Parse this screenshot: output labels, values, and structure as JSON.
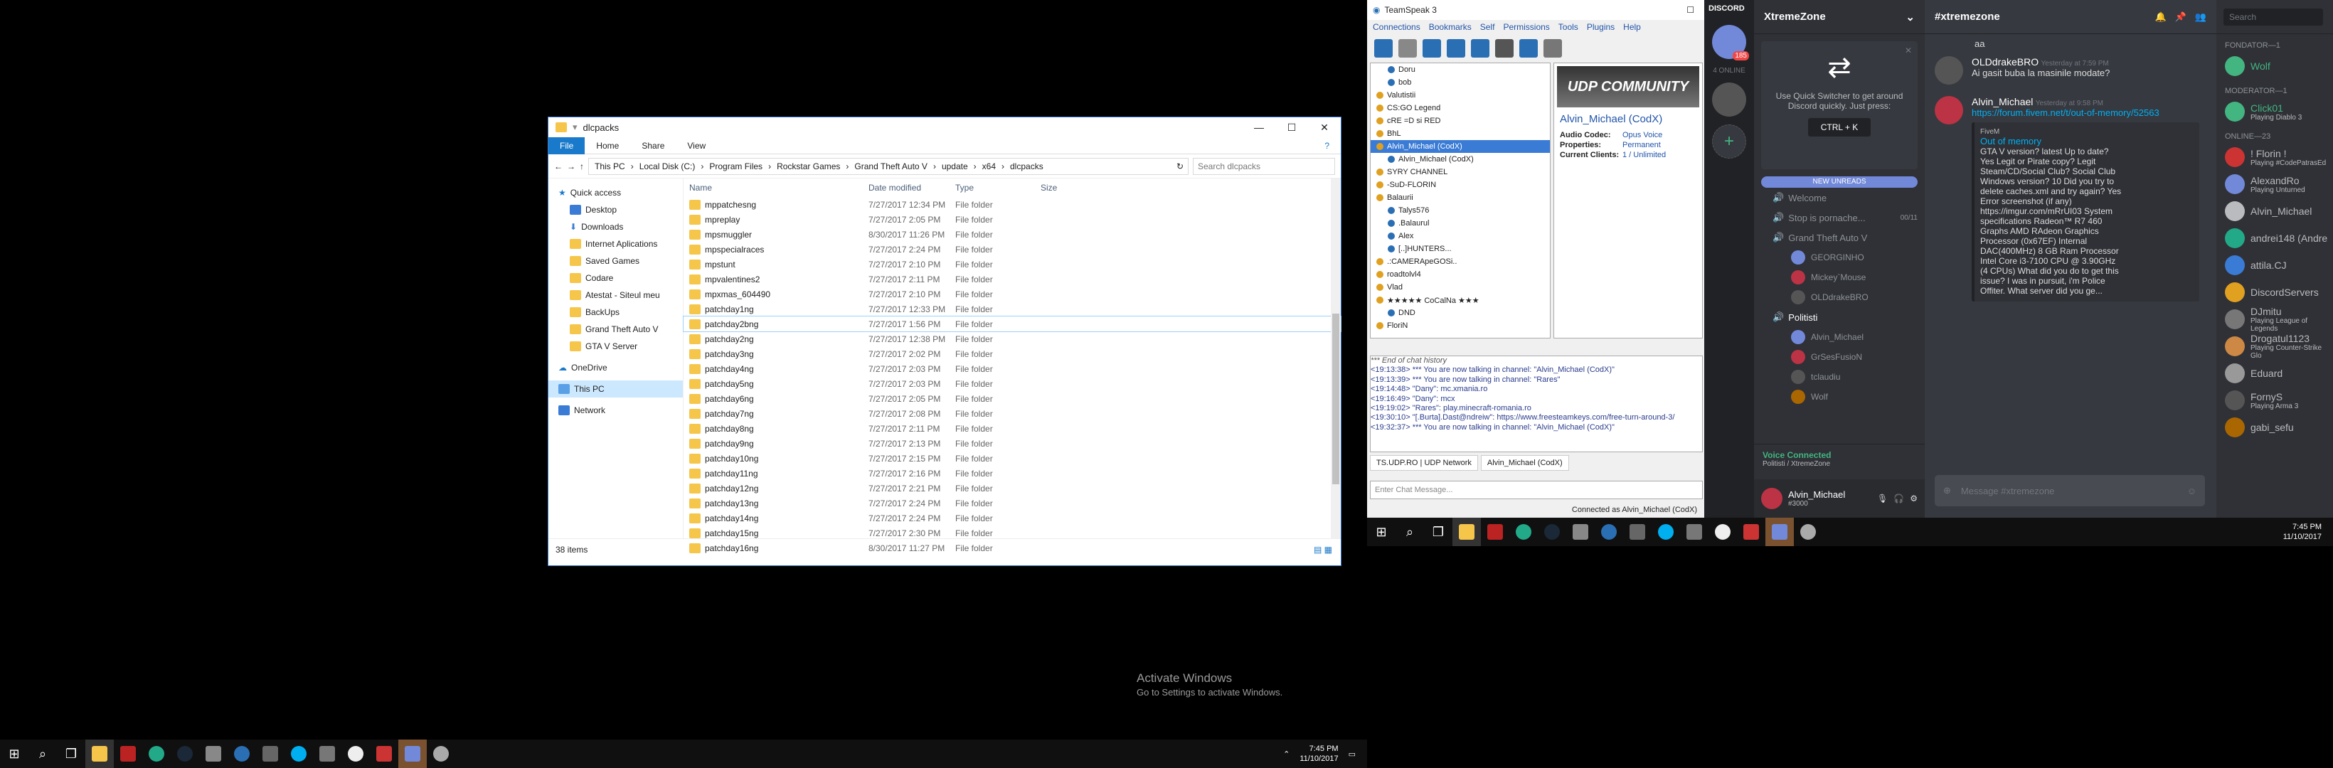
{
  "explorer": {
    "title": "dlcpacks",
    "tabs": [
      "File",
      "Home",
      "Share",
      "View"
    ],
    "path": [
      "This PC",
      "Local Disk (C:)",
      "Program Files",
      "Rockstar Games",
      "Grand Theft Auto V",
      "update",
      "x64",
      "dlcpacks"
    ],
    "search_placeholder": "Search dlcpacks",
    "nav": {
      "quick_access": "Quick access",
      "items": [
        "Desktop",
        "Downloads",
        "Internet Aplications",
        "Saved Games",
        "Codare",
        "Atestat - Siteul meu",
        "BackUps",
        "Grand Theft Auto V",
        "GTA V Server"
      ],
      "onedrive": "OneDrive",
      "this_pc": "This PC",
      "network": "Network"
    },
    "columns": {
      "name": "Name",
      "date": "Date modified",
      "type": "Type",
      "size": "Size"
    },
    "rows": [
      {
        "name": "mppatchesng",
        "date": "7/27/2017 12:34 PM",
        "type": "File folder"
      },
      {
        "name": "mpreplay",
        "date": "7/27/2017 2:05 PM",
        "type": "File folder"
      },
      {
        "name": "mpsmuggler",
        "date": "8/30/2017 11:26 PM",
        "type": "File folder"
      },
      {
        "name": "mpspecialraces",
        "date": "7/27/2017 2:24 PM",
        "type": "File folder"
      },
      {
        "name": "mpstunt",
        "date": "7/27/2017 2:10 PM",
        "type": "File folder"
      },
      {
        "name": "mpvalentines2",
        "date": "7/27/2017 2:11 PM",
        "type": "File folder"
      },
      {
        "name": "mpxmas_604490",
        "date": "7/27/2017 2:10 PM",
        "type": "File folder"
      },
      {
        "name": "patchday1ng",
        "date": "7/27/2017 12:33 PM",
        "type": "File folder"
      },
      {
        "name": "patchday2bng",
        "date": "7/27/2017 1:56 PM",
        "type": "File folder"
      },
      {
        "name": "patchday2ng",
        "date": "7/27/2017 12:38 PM",
        "type": "File folder"
      },
      {
        "name": "patchday3ng",
        "date": "7/27/2017 2:02 PM",
        "type": "File folder"
      },
      {
        "name": "patchday4ng",
        "date": "7/27/2017 2:03 PM",
        "type": "File folder"
      },
      {
        "name": "patchday5ng",
        "date": "7/27/2017 2:03 PM",
        "type": "File folder"
      },
      {
        "name": "patchday6ng",
        "date": "7/27/2017 2:05 PM",
        "type": "File folder"
      },
      {
        "name": "patchday7ng",
        "date": "7/27/2017 2:08 PM",
        "type": "File folder"
      },
      {
        "name": "patchday8ng",
        "date": "7/27/2017 2:11 PM",
        "type": "File folder"
      },
      {
        "name": "patchday9ng",
        "date": "7/27/2017 2:13 PM",
        "type": "File folder"
      },
      {
        "name": "patchday10ng",
        "date": "7/27/2017 2:15 PM",
        "type": "File folder"
      },
      {
        "name": "patchday11ng",
        "date": "7/27/2017 2:16 PM",
        "type": "File folder"
      },
      {
        "name": "patchday12ng",
        "date": "7/27/2017 2:21 PM",
        "type": "File folder"
      },
      {
        "name": "patchday13ng",
        "date": "7/27/2017 2:24 PM",
        "type": "File folder"
      },
      {
        "name": "patchday14ng",
        "date": "7/27/2017 2:24 PM",
        "type": "File folder"
      },
      {
        "name": "patchday15ng",
        "date": "7/27/2017 2:30 PM",
        "type": "File folder"
      },
      {
        "name": "patchday16ng",
        "date": "8/30/2017 11:27 PM",
        "type": "File folder"
      }
    ],
    "status": "38 items"
  },
  "teamspeak": {
    "title": "TeamSpeak 3",
    "menu": [
      "Connections",
      "Bookmarks",
      "Self",
      "Permissions",
      "Tools",
      "Plugins",
      "Help"
    ],
    "tree": [
      "Doru",
      "bob",
      "Valutistii",
      "CS:GO Legend",
      "cRE =D si RED",
      "BhL",
      "Alvin_Michael (CodX)",
      "Alvin_Michael (CodX)",
      "SYRY CHANNEL",
      "-SuD-FLORIN",
      "Balaurii",
      "Talys576",
      ".Balaurul",
      "Alex",
      "[..]HUNTERS...",
      ".:CAMERApeGOSi..",
      "roadtolvl4",
      "Vlad",
      "★★★★★ CoCalNa ★★★",
      "DND",
      "FloriN"
    ],
    "banner": "UDP COMMUNITY",
    "selected_client": "Alvin_Michael (CodX)",
    "info": [
      {
        "k": "Audio Codec:",
        "v": "Opus Voice"
      },
      {
        "k": "Properties:",
        "v": "Permanent"
      },
      {
        "k": "Current Clients:",
        "v": "1 / Unlimited"
      }
    ],
    "chat": [
      "*** End of chat history",
      "<19:13:38> *** You are now talking in channel: \"Alvin_Michael (CodX)\"",
      "<19:13:39> *** You are now talking in channel: \"Rares\"",
      "<19:14:48> \"Dany\": mc.xmania.ro",
      "<19:16:49> \"Dany\": mcx",
      "<19:19:02> \"Rares\": play.minecraft-romania.ro",
      "<19:30:10> \"[.Burta].Dast@ndreiw\": https://www.freesteamkeys.com/free-turn-around-3/",
      "<19:32:37> *** You are now talking in channel: \"Alvin_Michael (CodX)\""
    ],
    "tabs": [
      "TS.UDP.RO | UDP Network",
      "Alvin_Michael (CodX)"
    ],
    "input_placeholder": "Enter Chat Message...",
    "status": "Connected as Alvin_Michael (CodX)"
  },
  "discord": {
    "brand": "DISCORD",
    "server": "XtremeZone",
    "online": "4 ONLINE",
    "badge": "185",
    "quickswitch": {
      "text": "Use Quick Switcher to get around Discord quickly. Just press:",
      "keys": "CTRL + K"
    },
    "new_unreads": "NEW UNREADS",
    "channels": [
      "Welcome",
      "Stop is pornache...",
      "Grand Theft Auto V"
    ],
    "channel_count": "00/11",
    "voice_users_1": [
      "GEORGINHO",
      "Mickey`Mouse",
      "OLDdrakeBRO"
    ],
    "voice_channel_2": "Politisti",
    "voice_users_2": [
      "Alvin_Michael",
      "GrSesFusioN",
      "tclaudiu",
      "Wolf"
    ],
    "voice_connected": "Voice Connected",
    "voice_sub": "Politisti / XtremeZone",
    "user": {
      "name": "Alvin_Michael",
      "tag": "#3000"
    },
    "channel_title": "#xtremezone",
    "search": "Search",
    "messages": [
      {
        "author": "OLDdrakeBRO",
        "time": "Yesterday at 7:59 PM",
        "text": "Ai gasit buba la masinile modate?"
      },
      {
        "author": "Alvin_Michael",
        "time": "Yesterday at 9:58 PM",
        "link": "https://forum.fivem.net/t/out-of-memory/52563",
        "embed_title": "Out of memory",
        "embed_site": "FiveM",
        "embed_text": "GTA V version? latest Up to date? Yes Legit or Pirate copy? Legit Steam/CD/Social Club? Social Club Windows version? 10 Did you try to delete caches.xml and try again? Yes Error screenshot (if any) https://imgur.com/mRrUI03 System specifications Radeon™ R7 460 Graphs AMD RAdeon Graphics Processor (0x67EF) Internal DAC(400MHz) 8 GB Ram Processor Intel Core i3-7100 CPU @ 3.90GHz (4 CPUs) What did you do to get this issue? I was in pursuit, i'm Police Offiter. What server did you ge..."
      }
    ],
    "first_line": "aa",
    "input_placeholder": "Message #xtremezone",
    "member_groups": [
      {
        "label": "FONDATOR—1",
        "members": [
          {
            "name": "Wolf",
            "sub": ""
          }
        ]
      },
      {
        "label": "MODERATOR—1",
        "members": [
          {
            "name": "Click01",
            "sub": "Playing Diablo 3"
          }
        ]
      },
      {
        "label": "ONLINE—23",
        "members": [
          {
            "name": "! Florin !",
            "sub": "Playing #CodePatrasEd"
          },
          {
            "name": "AlexandRo",
            "sub": "Playing Unturned"
          },
          {
            "name": "Alvin_Michael",
            "sub": ""
          },
          {
            "name": "andrei148 (Andre",
            "sub": ""
          },
          {
            "name": "attila.CJ",
            "sub": ""
          },
          {
            "name": "DiscordServers",
            "sub": ""
          },
          {
            "name": "DJmitu",
            "sub": "Playing League of Legends"
          },
          {
            "name": "Drogatul1123",
            "sub": "Playing Counter-Strike Glo"
          },
          {
            "name": "Eduard",
            "sub": ""
          },
          {
            "name": "FornyS",
            "sub": "Playing Arma 3"
          },
          {
            "name": "gabi_sefu",
            "sub": ""
          }
        ]
      }
    ]
  },
  "taskbar_right": {
    "time": "7:45 PM",
    "date": "11/10/2017"
  },
  "taskbar_left": {
    "time": "7:45 PM",
    "date": "11/10/2017"
  },
  "activate": {
    "title": "Activate Windows",
    "sub": "Go to Settings to activate Windows."
  },
  "colors": {
    "accent": "#1979ca",
    "discord_bg": "#36393f",
    "discord_link": "#00b0f4"
  }
}
